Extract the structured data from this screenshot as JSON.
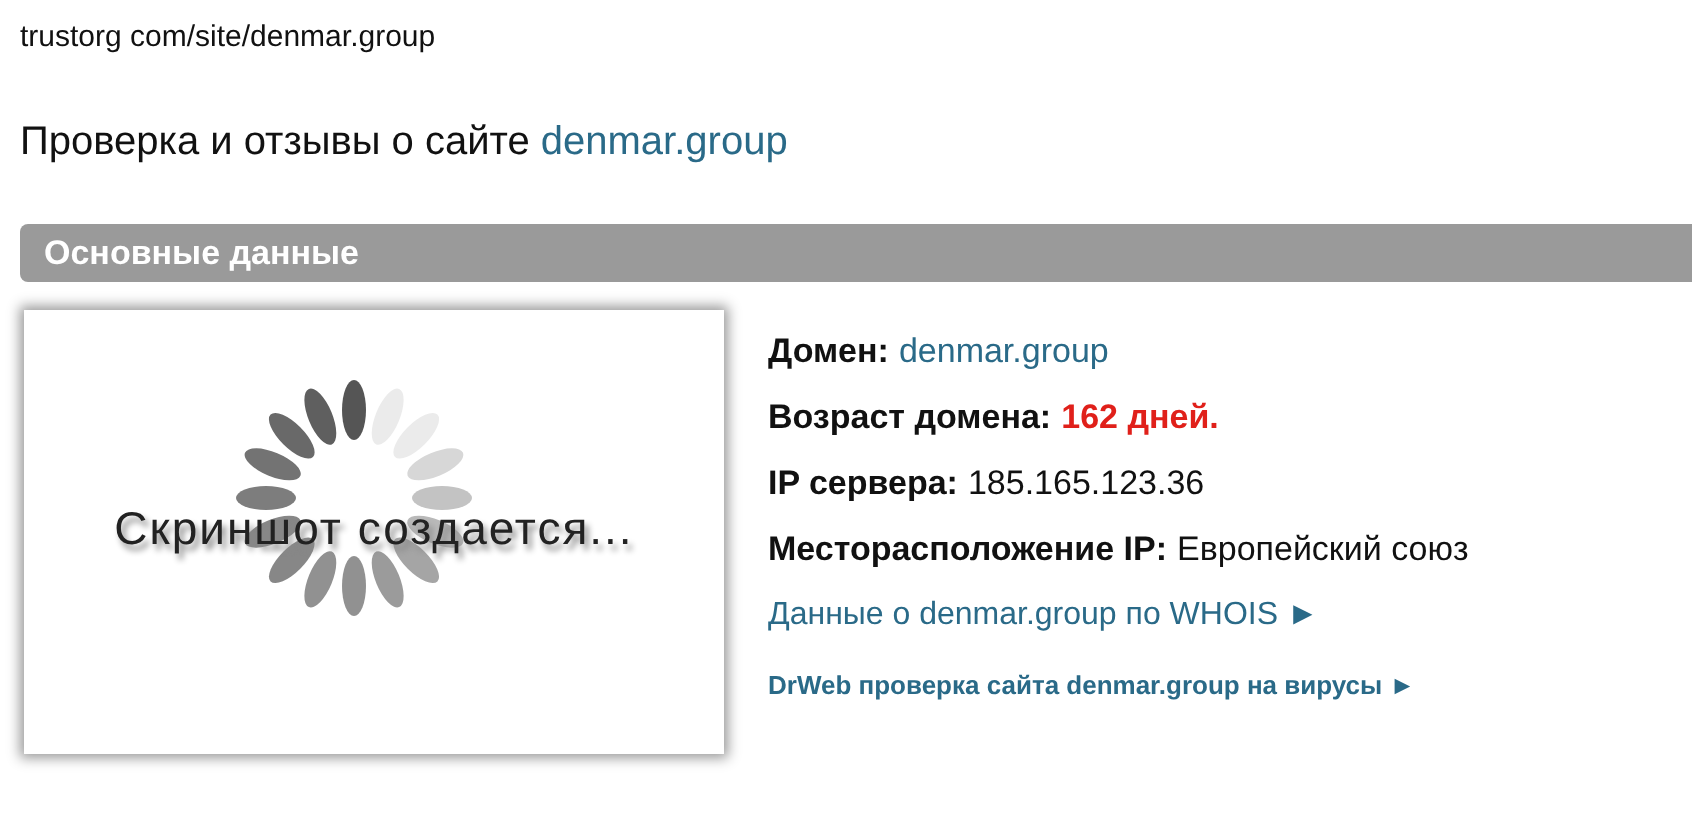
{
  "url": "trustorg com/site/denmar.group",
  "heading": {
    "text": "Проверка и отзывы о сайте ",
    "link": "denmar.group"
  },
  "section": {
    "title": "Основные данные"
  },
  "screenshot": {
    "caption": "Скриншот создается..."
  },
  "info": [
    {
      "label": "Домен:",
      "value": "denmar.group",
      "kind": "link"
    },
    {
      "label": "Возраст домена:",
      "value": "162 дней.",
      "kind": "alert"
    },
    {
      "label": "IP сервера:",
      "value": "185.165.123.36",
      "kind": "plain"
    },
    {
      "label": "Месторасположение IP:",
      "value": "Европейский союз",
      "kind": "plain"
    }
  ],
  "links": [
    {
      "text": "Данные о denmar.group по WHOIS ►",
      "kind": "large"
    },
    {
      "text": "DrWeb проверка сайта denmar.group на вирусы ►",
      "kind": "small"
    }
  ]
}
